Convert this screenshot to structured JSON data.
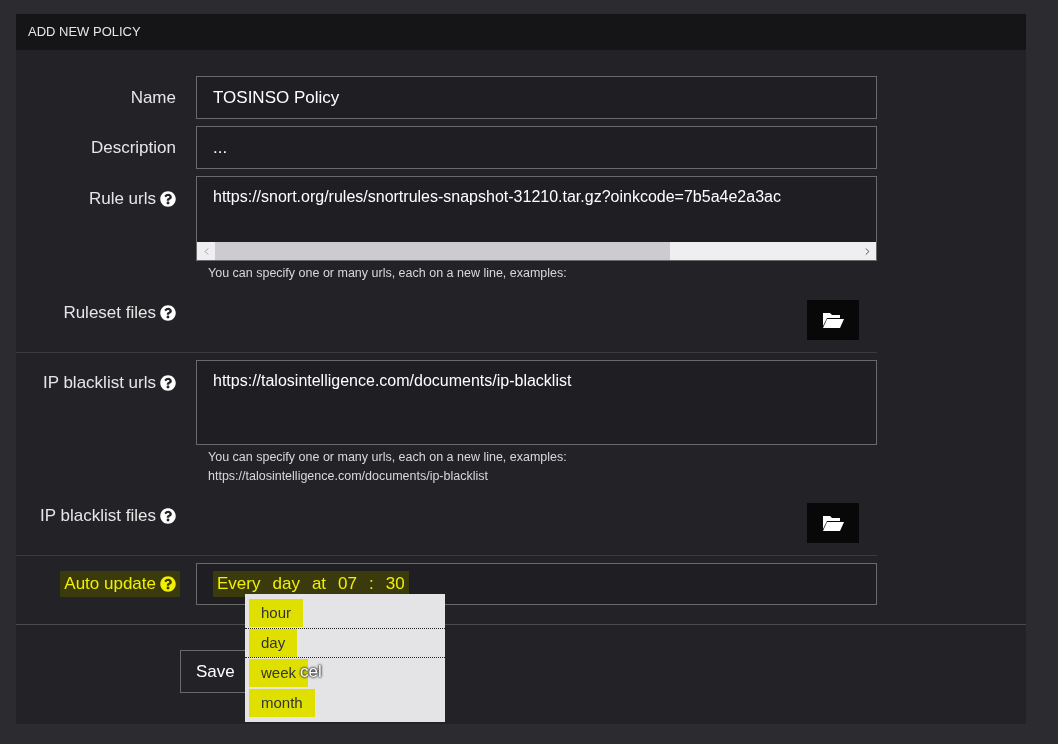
{
  "panel": {
    "title": "ADD NEW POLICY"
  },
  "fields": [
    {
      "kind": "text",
      "label": "Name",
      "help": false,
      "value": "TOSINSO Policy"
    },
    {
      "kind": "text",
      "label": "Description",
      "help": false,
      "value": "..."
    },
    {
      "kind": "textarea",
      "label": "Rule urls",
      "help": true,
      "value": "https://snort.org/rules/snortrules-snapshot-31210.tar.gz?oinkcode=7b5a4e2a3ac",
      "scrollbar": true,
      "hint": [
        "You can specify one or many urls, each on a new line, examples:"
      ]
    },
    {
      "kind": "file",
      "label": "Ruleset files",
      "help": true
    },
    {
      "kind": "textarea",
      "label": "IP blacklist urls",
      "help": true,
      "value": "https://talosintelligence.com/documents/ip-blacklist",
      "scrollbar": false,
      "hint": [
        "You can specify one or many urls, each on a new line, examples:",
        "https://talosintelligence.com/documents/ip-blacklist"
      ]
    },
    {
      "kind": "file",
      "label": "IP blacklist files",
      "help": true
    },
    {
      "kind": "schedule",
      "label": "Auto update",
      "help": true,
      "highlighted": true,
      "parts": [
        "Every",
        "day",
        "at",
        "07",
        ":",
        "30"
      ]
    }
  ],
  "dropdown": {
    "options": [
      {
        "label": "hour",
        "selected": false,
        "highlighted": true
      },
      {
        "label": "day",
        "selected": true,
        "highlighted": true
      },
      {
        "label": "week",
        "selected": false,
        "highlighted": true
      },
      {
        "label": "month",
        "selected": false,
        "highlighted": true
      }
    ]
  },
  "buttons": [
    {
      "kind": "primary",
      "label": "Save"
    },
    {
      "kind": "cancel",
      "label": "cel"
    }
  ]
}
